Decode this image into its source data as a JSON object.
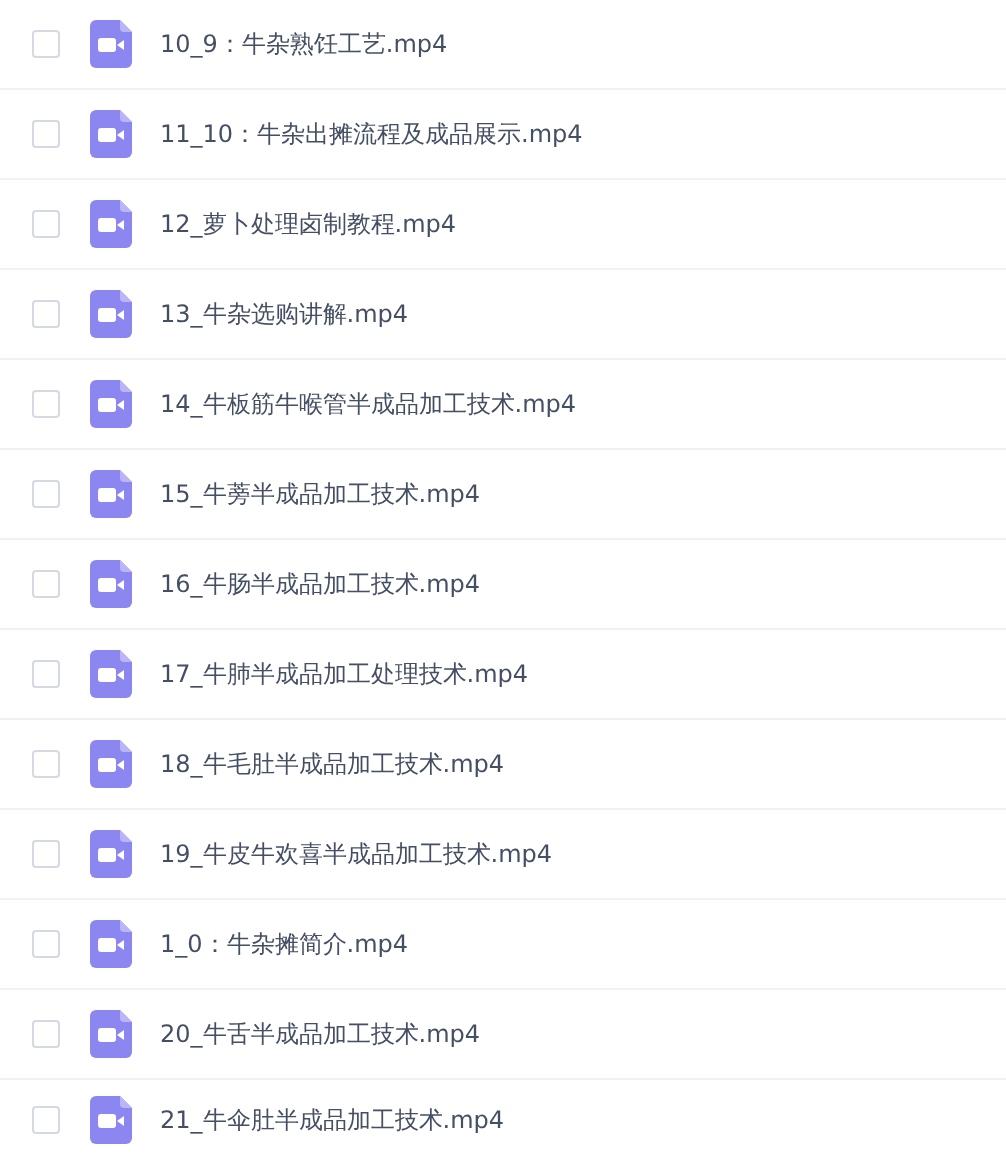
{
  "files": [
    {
      "name": "10_9：牛杂熟饪工艺.mp4",
      "checked": false
    },
    {
      "name": "11_10：牛杂出摊流程及成品展示.mp4",
      "checked": false
    },
    {
      "name": "12_萝卜处理卤制教程.mp4",
      "checked": false
    },
    {
      "name": "13_牛杂选购讲解.mp4",
      "checked": false
    },
    {
      "name": "14_牛板筋牛喉管半成品加工技术.mp4",
      "checked": false
    },
    {
      "name": "15_牛蒡半成品加工技术.mp4",
      "checked": false
    },
    {
      "name": "16_牛肠半成品加工技术.mp4",
      "checked": false
    },
    {
      "name": "17_牛肺半成品加工处理技术.mp4",
      "checked": false
    },
    {
      "name": "18_牛毛肚半成品加工技术.mp4",
      "checked": false
    },
    {
      "name": "19_牛皮牛欢喜半成品加工技术.mp4",
      "checked": false
    },
    {
      "name": "1_0：牛杂摊简介.mp4",
      "checked": false
    },
    {
      "name": "20_牛舌半成品加工技术.mp4",
      "checked": false
    },
    {
      "name": "21_牛伞肚半成品加工技术.mp4",
      "checked": false
    }
  ]
}
